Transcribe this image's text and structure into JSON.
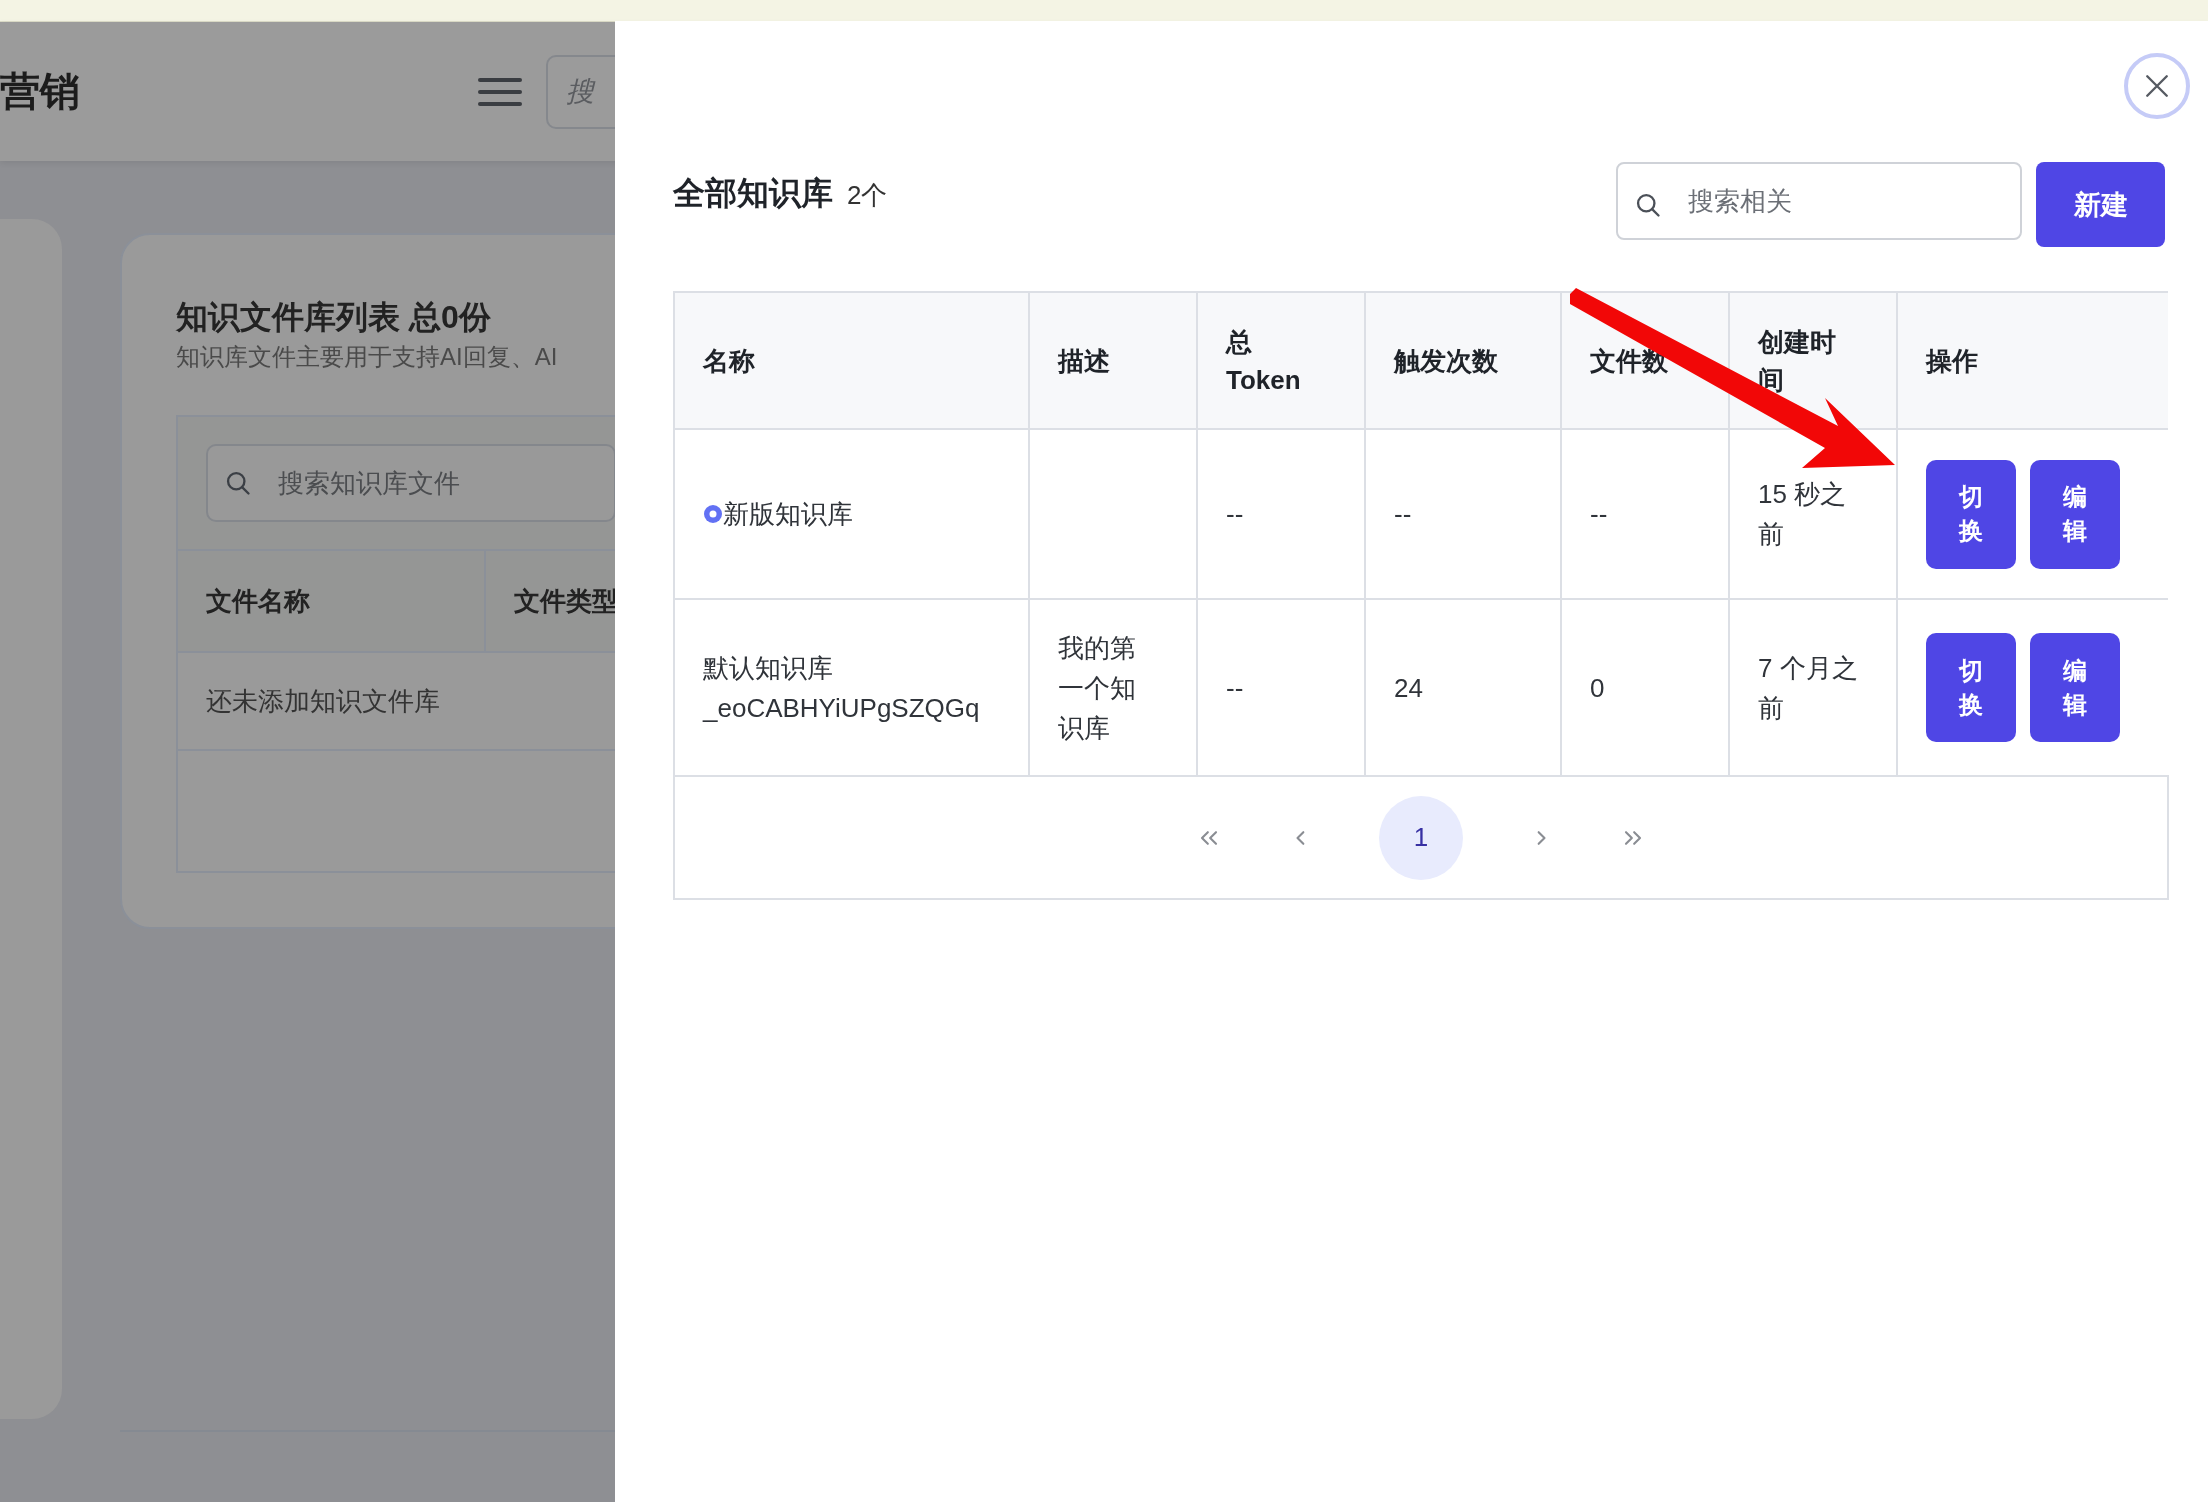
{
  "background_page": {
    "title": "营销",
    "search": {
      "placeholder": "搜"
    },
    "panel": {
      "title": "知识文件库列表 总0份",
      "subtitle": "知识库文件主要用于支持AI回复、AI",
      "search": {
        "placeholder": "搜索知识库文件"
      },
      "columns": [
        "文件名称",
        "文件类型"
      ],
      "empty_text": "还未添加知识文件库"
    }
  },
  "drawer": {
    "title": "全部知识库",
    "count": "2个",
    "search": {
      "placeholder": "搜索相关"
    },
    "new_button": "新建",
    "table": {
      "columns": [
        "名称",
        "描述",
        "总 Token",
        "触发次数",
        "文件数",
        "创建时间",
        "操作"
      ],
      "rows": [
        {
          "name": "新版知识库",
          "current": true,
          "token": "--",
          "triggers": "--",
          "files": "--",
          "created": "15 秒之前",
          "actions": [
            "切换",
            "编辑"
          ]
        },
        {
          "name": "默认知识库 _eoCABHYiUPgSZQGq",
          "current": false,
          "description": "我的第一个知识库",
          "token": "--",
          "triggers": "24",
          "files": "0",
          "created": "7 个月之前",
          "actions": [
            "切换",
            "编辑"
          ]
        }
      ]
    },
    "pagination": {
      "pages": [
        {
          "label": "1",
          "selected": true
        }
      ]
    }
  }
}
